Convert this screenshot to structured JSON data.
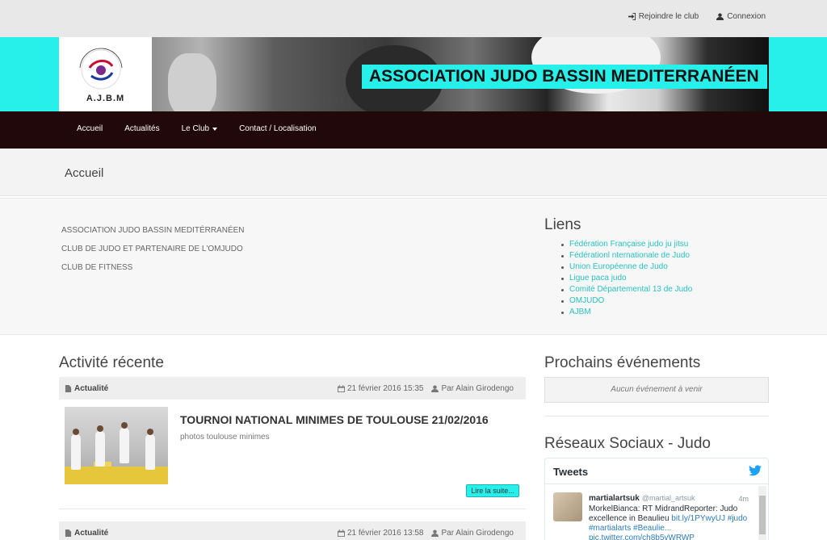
{
  "topbar": {
    "join_label": "Rejoindre le club",
    "login_label": "Connexion"
  },
  "banner": {
    "logo_abbr": "A.J.B.M",
    "title": "ASSOCIATION JUDO BASSIN MEDITERRANÉEN"
  },
  "nav": {
    "items": [
      "Accueil",
      "Actualités",
      "Le Club",
      "Contact / Localisation"
    ]
  },
  "breadcrumb": {
    "current": "Accueil"
  },
  "intro": {
    "lines": [
      "ASSOCIATION JUDO BASSIN MEDITÉRRANÉEN",
      "CLUB DE JUDO ET PARTENAIRE DE L'OMJUDO",
      "CLUB DE FITNESS"
    ],
    "links_title": "Liens",
    "links": [
      "Fédération Française judo ju jitsu",
      "Fédérationl nternationale de Judo",
      "Union Européenne de Judo",
      "Ligue paca judo",
      "Comité Départemental 13 de Judo",
      "OMJUDO",
      "AJBM"
    ]
  },
  "recent": {
    "heading": "Activité récente",
    "articles": [
      {
        "category": "Actualité",
        "date": "21 février 2016 15:35",
        "author": "Par Alain Girodengo",
        "title": "TOURNOI NATIONAL MINIMES DE TOULOUSE 21/02/2016",
        "summary": "photos toulouse minimes",
        "more_label": "Lire la suite..."
      },
      {
        "category": "Actualité",
        "date": "21 février 2016 13:58",
        "author": "Par Alain Girodengo"
      }
    ]
  },
  "events": {
    "heading": "Prochains événements",
    "empty_text": "Aucun événement à venir"
  },
  "social": {
    "heading": "Réseaux Sociaux - Judo",
    "widget_title": "Tweets",
    "tweet": {
      "user": "martialartsuk",
      "handle": "@martial_artsuk",
      "time": "4m",
      "text": "MorkelBianca: RT MidrandReporter: Judo excellence in Beaulieu",
      "link1": "bit.ly/1PYwyUJ",
      "hashtags": "#judo #martialarts #Beaulie...",
      "link2": "pic.twitter.com/ch8b5vWRWP"
    }
  },
  "colors": {
    "accent": "#27f0ea",
    "nav_bg": "#21080a",
    "link": "#27c1bf"
  }
}
